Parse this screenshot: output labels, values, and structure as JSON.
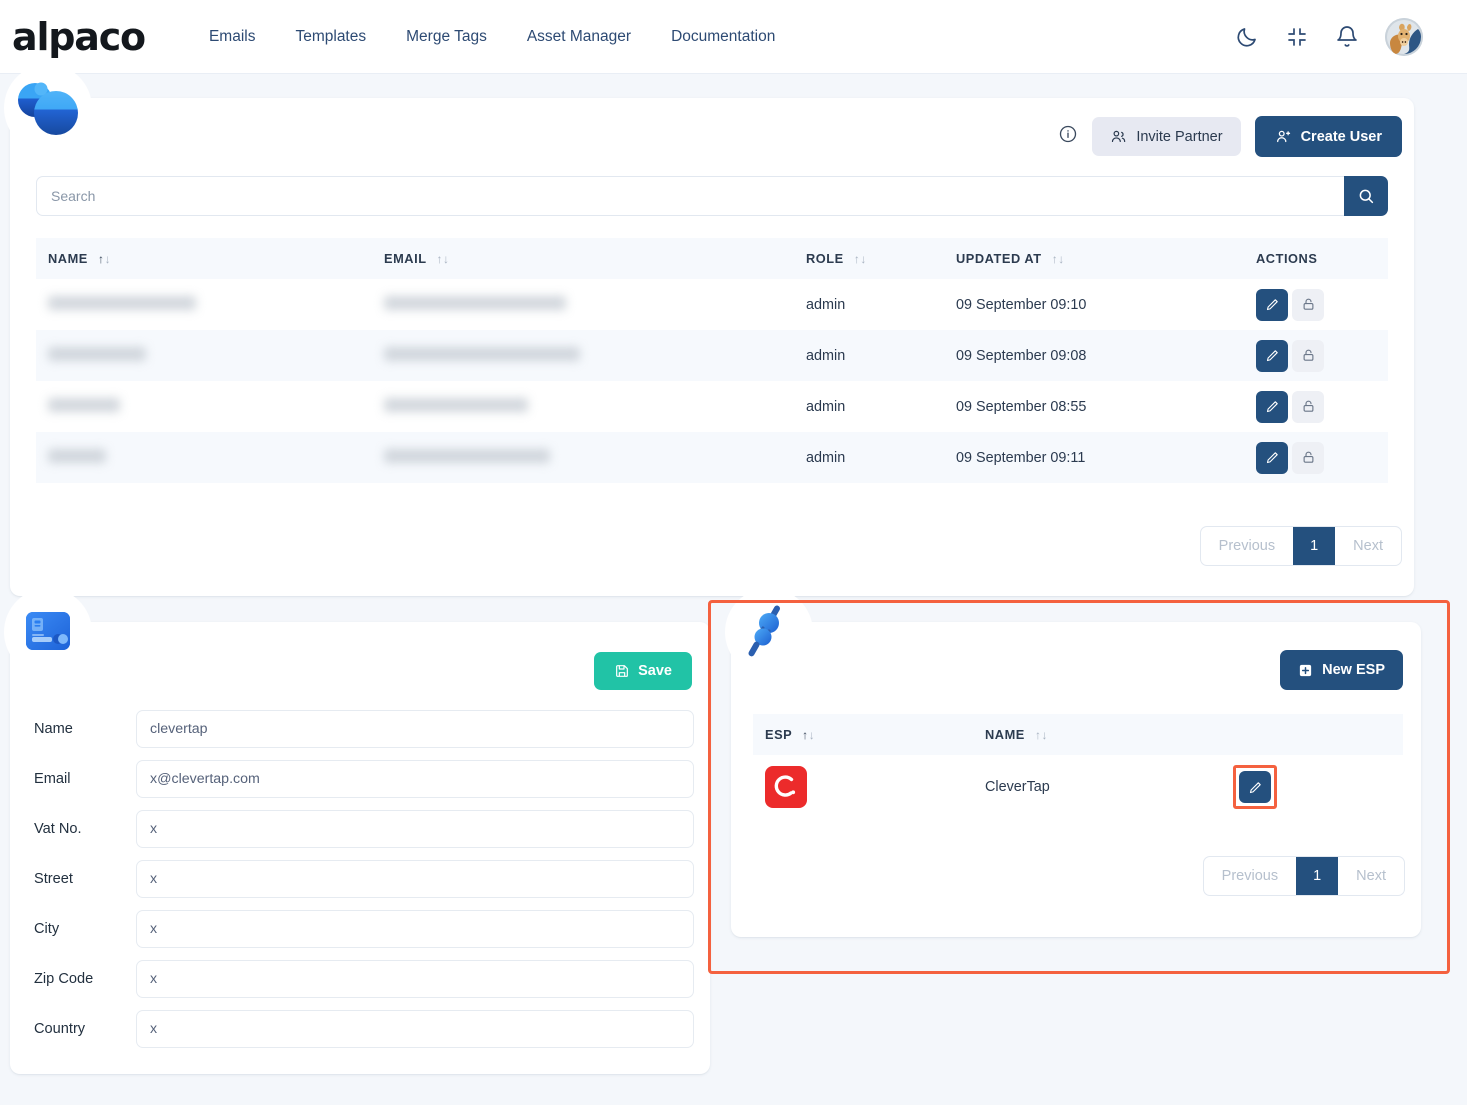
{
  "navbar": {
    "brand": "alpaco",
    "links": [
      {
        "label": "Emails"
      },
      {
        "label": "Templates"
      },
      {
        "label": "Merge Tags"
      },
      {
        "label": "Asset Manager"
      },
      {
        "label": "Documentation"
      }
    ],
    "icons": [
      {
        "name": "moon-icon",
        "title": "Dark mode"
      },
      {
        "name": "collapse-icon",
        "title": "Collapse"
      },
      {
        "name": "bell-icon",
        "title": "Notifications"
      }
    ],
    "avatar_alt": "alpaca-avatar"
  },
  "users_card": {
    "badge_icon": "users-spheres-icon",
    "info_icon": "info-icon",
    "invite_partner_label": "Invite Partner",
    "create_user_label": "Create User",
    "search": {
      "value": "",
      "placeholder": "Search",
      "button_icon": "search-icon"
    },
    "columns": [
      {
        "label": "NAME",
        "sortable": true
      },
      {
        "label": "EMAIL",
        "sortable": true
      },
      {
        "label": "ROLE",
        "sortable": true
      },
      {
        "label": "UPDATED AT",
        "sortable": true
      },
      {
        "label": "ACTIONS",
        "sortable": false
      }
    ],
    "rows": [
      {
        "name": "",
        "email": "",
        "role": "admin",
        "updated_at": "09 September 09:10",
        "name_redacted": true,
        "email_redacted": true,
        "name_w": 148,
        "email_w": 182
      },
      {
        "name": "",
        "email": "",
        "role": "admin",
        "updated_at": "09 September 09:08",
        "name_redacted": true,
        "email_redacted": true,
        "name_w": 98,
        "email_w": 196
      },
      {
        "name": "",
        "email": "",
        "role": "admin",
        "updated_at": "09 September 08:55",
        "name_redacted": true,
        "email_redacted": true,
        "name_w": 72,
        "email_w": 144
      },
      {
        "name": "",
        "email": "",
        "role": "admin",
        "updated_at": "09 September 09:11",
        "name_redacted": true,
        "email_redacted": true,
        "name_w": 58,
        "email_w": 166
      }
    ],
    "row_actions": {
      "edit_icon": "pencil-icon",
      "lock_icon": "unlock-icon"
    },
    "pagination": {
      "previous": "Previous",
      "current": "1",
      "next": "Next"
    }
  },
  "profile_card": {
    "badge_icon": "id-card-icon",
    "save_label": "Save",
    "save_icon": "save-disk-icon",
    "save_color": "#21c3a6",
    "fields": [
      {
        "label": "Name",
        "value": "clevertap"
      },
      {
        "label": "Email",
        "value": "x@clevertap.com"
      },
      {
        "label": "Vat No.",
        "value": "x"
      },
      {
        "label": "Street",
        "value": "x"
      },
      {
        "label": "City",
        "value": "x"
      },
      {
        "label": "Zip Code",
        "value": "x"
      },
      {
        "label": "Country",
        "value": "x"
      }
    ]
  },
  "esp_card": {
    "badge_icon": "plug-connector-icon",
    "new_esp_label": "New ESP",
    "new_esp_icon": "plus-square-icon",
    "highlight_color": "#f4613f",
    "columns": [
      {
        "label": "ESP",
        "sortable": true
      },
      {
        "label": "NAME",
        "sortable": true
      },
      {
        "label": "",
        "sortable": false
      }
    ],
    "rows": [
      {
        "esp_logo": "clevertap-logo",
        "esp_logo_color": "#ec2b2b",
        "name": "CleverTap",
        "edit_icon": "pencil-icon",
        "edit_highlighted": true
      }
    ],
    "pagination": {
      "previous": "Previous",
      "current": "1",
      "next": "Next"
    }
  },
  "theme": {
    "primary": "#24507e",
    "accent_green": "#21c3a6",
    "highlight": "#f4613f",
    "page_bg": "#f4f7fb"
  }
}
